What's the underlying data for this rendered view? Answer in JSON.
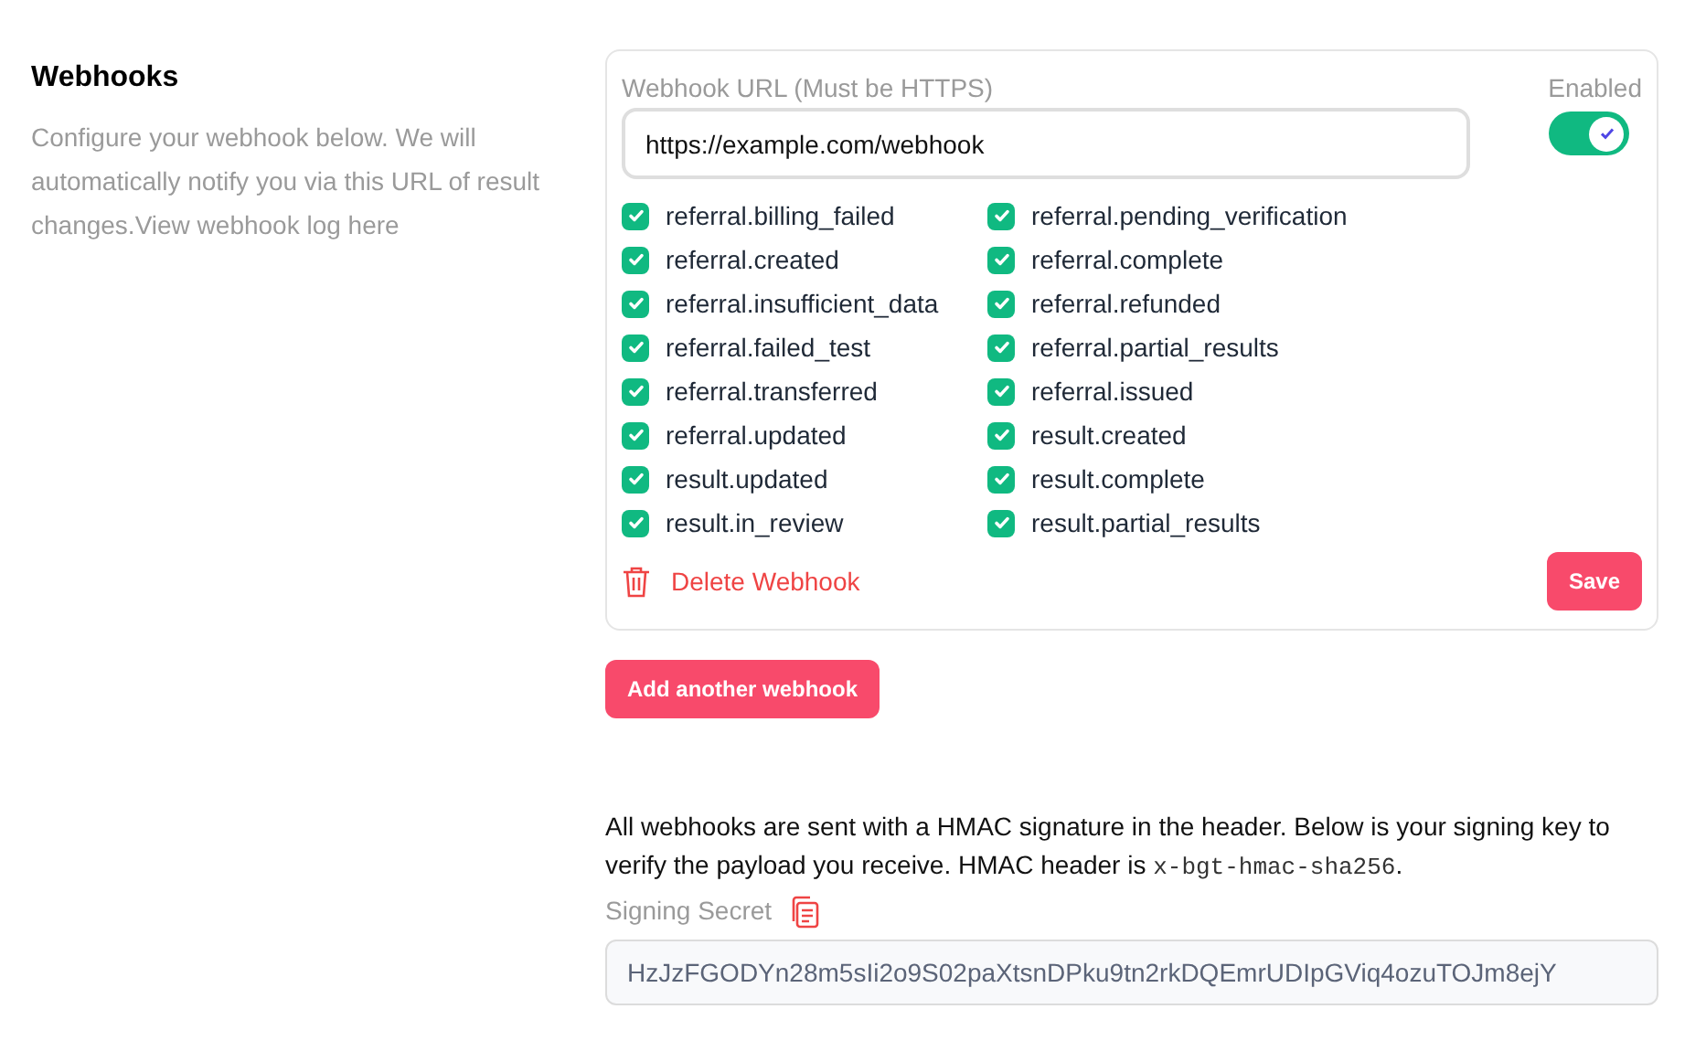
{
  "section": {
    "title": "Webhooks",
    "description": "Configure your webhook below. We will automatically notify you via this URL of result changes.View webhook log here"
  },
  "webhook": {
    "url_label": "Webhook URL (Must be HTTPS)",
    "url": "https://example.com/webhook",
    "enabled_label": "Enabled",
    "enabled": true,
    "events": [
      {
        "label": "referral.billing_failed",
        "checked": true
      },
      {
        "label": "referral.pending_verification",
        "checked": true
      },
      {
        "label": "referral.created",
        "checked": true
      },
      {
        "label": "referral.complete",
        "checked": true
      },
      {
        "label": "referral.insufficient_data",
        "checked": true
      },
      {
        "label": "referral.refunded",
        "checked": true
      },
      {
        "label": "referral.failed_test",
        "checked": true
      },
      {
        "label": "referral.partial_results",
        "checked": true
      },
      {
        "label": "referral.transferred",
        "checked": true
      },
      {
        "label": "referral.issued",
        "checked": true
      },
      {
        "label": "referral.updated",
        "checked": true
      },
      {
        "label": "result.created",
        "checked": true
      },
      {
        "label": "result.updated",
        "checked": true
      },
      {
        "label": "result.complete",
        "checked": true
      },
      {
        "label": "result.in_review",
        "checked": true
      },
      {
        "label": "result.partial_results",
        "checked": true
      }
    ],
    "delete_label": "Delete Webhook",
    "save_label": "Save"
  },
  "add_button": "Add another webhook",
  "signing": {
    "note": [
      {
        "kind": "text",
        "text": "All webhooks are sent with a HMAC signature in the header. Below is your signing key to verify the payload you receive. HMAC header is "
      },
      {
        "kind": "code",
        "text": "x-bgt-hmac-sha256"
      },
      {
        "kind": "text",
        "text": "."
      }
    ],
    "label": "Signing Secret",
    "secret": "HzJzFGODYn28m5sIi2o9S02paXtsnDPku9tn2rkDQEmrUDIpGViq4ozuTOJm8ejY"
  }
}
